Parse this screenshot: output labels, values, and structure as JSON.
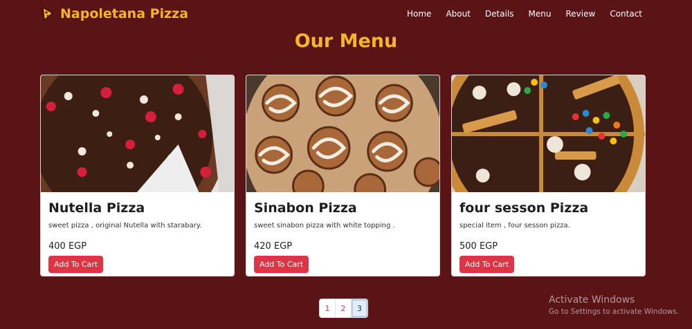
{
  "navbar": {
    "brand": "Napoletana Pizza",
    "brand_icon": "pizza-slice-icon",
    "links": [
      "Home",
      "About",
      "Details",
      "Menu",
      "Review",
      "Contact"
    ]
  },
  "page": {
    "title": "Our Menu"
  },
  "cards": [
    {
      "title": "Nutella Pizza",
      "description": "sweet pizza , original Nutella with starabary.",
      "price": "400 EGP",
      "button": "Add To Cart"
    },
    {
      "title": "Sinabon Pizza",
      "description": "sweet sinabon pizza with white topping .",
      "price": "420 EGP",
      "button": "Add To Cart"
    },
    {
      "title": "four sesson Pizza",
      "description": "special item , four sesson pizza.",
      "price": "500 EGP",
      "button": "Add To Cart"
    }
  ],
  "pagination": {
    "pages": [
      "1",
      "2",
      "3"
    ],
    "active": "3"
  },
  "watermark": {
    "title": "Activate Windows",
    "subtitle": "Go to Settings to activate Windows."
  },
  "colors": {
    "background": "#5a1416",
    "brand": "#f5b52a",
    "button": "#dc3545"
  }
}
